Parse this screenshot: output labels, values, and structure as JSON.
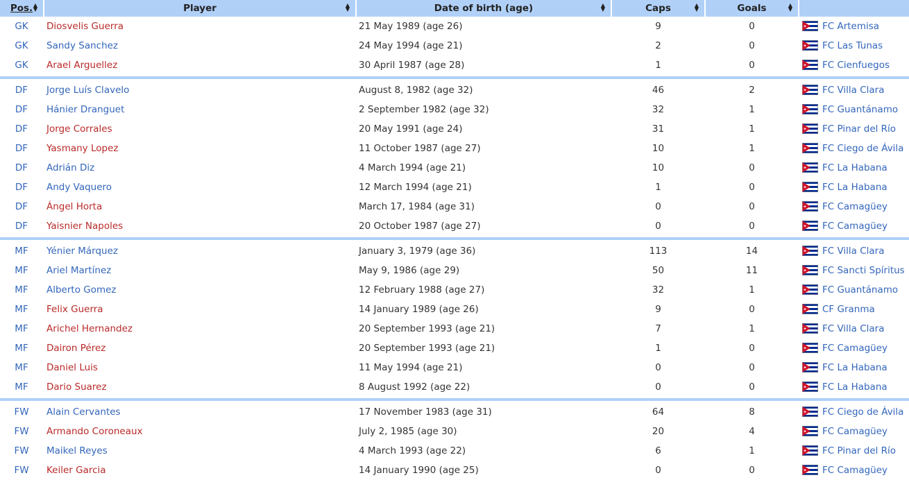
{
  "headers": {
    "pos": "Pos.",
    "player": "Player",
    "dob": "Date of birth (age)",
    "caps": "Caps",
    "goals": "Goals",
    "club": ""
  },
  "colors": {
    "header_bg": "#b0d0f8",
    "link_blue": "#3366bb",
    "redlink": "#ba2a2a"
  },
  "groups": [
    {
      "rows": [
        {
          "pos": "GK",
          "player": "Diosvelis Guerra",
          "red": true,
          "dob": "21 May 1989 (age 26)",
          "caps": "9",
          "goals": "0",
          "club": "FC Artemisa"
        },
        {
          "pos": "GK",
          "player": "Sandy Sanchez",
          "red": false,
          "dob": "24 May 1994 (age 21)",
          "caps": "2",
          "goals": "0",
          "club": "FC Las Tunas"
        },
        {
          "pos": "GK",
          "player": "Arael Arguellez",
          "red": true,
          "dob": "30 April 1987 (age 28)",
          "caps": "1",
          "goals": "0",
          "club": "FC Cienfuegos"
        }
      ]
    },
    {
      "rows": [
        {
          "pos": "DF",
          "player": "Jorge Luís Clavelo",
          "red": false,
          "dob": "August 8, 1982 (age 32)",
          "caps": "46",
          "goals": "2",
          "club": "FC Villa Clara"
        },
        {
          "pos": "DF",
          "player": "Hánier Dranguet",
          "red": false,
          "dob": "2 September 1982 (age 32)",
          "caps": "32",
          "goals": "1",
          "club": "FC Guantánamo"
        },
        {
          "pos": "DF",
          "player": "Jorge Corrales",
          "red": true,
          "dob": "20 May 1991 (age 24)",
          "caps": "31",
          "goals": "1",
          "club": "FC Pinar del Río"
        },
        {
          "pos": "DF",
          "player": "Yasmany Lopez",
          "red": true,
          "dob": "11 October 1987 (age 27)",
          "caps": "10",
          "goals": "1",
          "club": "FC Ciego de Ávila"
        },
        {
          "pos": "DF",
          "player": "Adrián Diz",
          "red": false,
          "dob": "4 March 1994 (age 21)",
          "caps": "10",
          "goals": "0",
          "club": "FC La Habana"
        },
        {
          "pos": "DF",
          "player": "Andy Vaquero",
          "red": false,
          "dob": "12 March 1994 (age 21)",
          "caps": "1",
          "goals": "0",
          "club": "FC La Habana"
        },
        {
          "pos": "DF",
          "player": "Ángel Horta",
          "red": true,
          "dob": "March 17, 1984 (age 31)",
          "caps": "0",
          "goals": "0",
          "club": "FC Camagüey"
        },
        {
          "pos": "DF",
          "player": "Yaisnier Napoles",
          "red": true,
          "dob": "20 October 1987 (age 27)",
          "caps": "0",
          "goals": "0",
          "club": "FC Camagüey"
        }
      ]
    },
    {
      "rows": [
        {
          "pos": "MF",
          "player": "Yénier Márquez",
          "red": false,
          "dob": "January 3, 1979 (age 36)",
          "caps": "113",
          "goals": "14",
          "club": "FC Villa Clara"
        },
        {
          "pos": "MF",
          "player": "Ariel Martínez",
          "red": false,
          "dob": "May 9, 1986 (age 29)",
          "caps": "50",
          "goals": "11",
          "club": "FC Sancti Spíritus"
        },
        {
          "pos": "MF",
          "player": "Alberto Gomez",
          "red": false,
          "dob": "12 February 1988 (age 27)",
          "caps": "32",
          "goals": "1",
          "club": "FC Guantánamo"
        },
        {
          "pos": "MF",
          "player": "Felix Guerra",
          "red": true,
          "dob": "14 January 1989 (age 26)",
          "caps": "9",
          "goals": "0",
          "club": "CF Granma"
        },
        {
          "pos": "MF",
          "player": "Arichel Hernandez",
          "red": true,
          "dob": "20 September 1993 (age 21)",
          "caps": "7",
          "goals": "1",
          "club": "FC Villa Clara"
        },
        {
          "pos": "MF",
          "player": "Dairon Pérez",
          "red": true,
          "dob": "20 September 1993 (age 21)",
          "caps": "1",
          "goals": "0",
          "club": "FC Camagüey"
        },
        {
          "pos": "MF",
          "player": "Daniel Luis",
          "red": true,
          "dob": "11 May 1994 (age 21)",
          "caps": "0",
          "goals": "0",
          "club": "FC La Habana"
        },
        {
          "pos": "MF",
          "player": "Dario Suarez",
          "red": true,
          "dob": "8 August 1992 (age 22)",
          "caps": "0",
          "goals": "0",
          "club": "FC La Habana"
        }
      ]
    },
    {
      "rows": [
        {
          "pos": "FW",
          "player": "Alain Cervantes",
          "red": false,
          "dob": "17 November 1983 (age 31)",
          "caps": "64",
          "goals": "8",
          "club": "FC Ciego de Ávila"
        },
        {
          "pos": "FW",
          "player": "Armando Coroneaux",
          "red": true,
          "dob": "July 2, 1985 (age 30)",
          "caps": "20",
          "goals": "4",
          "club": "FC Camagüey"
        },
        {
          "pos": "FW",
          "player": "Maikel Reyes",
          "red": false,
          "dob": "4 March 1993 (age 22)",
          "caps": "6",
          "goals": "1",
          "club": "FC Pinar del Río"
        },
        {
          "pos": "FW",
          "player": "Keiler Garcia",
          "red": true,
          "dob": "14 January 1990 (age 25)",
          "caps": "0",
          "goals": "0",
          "club": "FC Camagüey"
        }
      ]
    }
  ]
}
